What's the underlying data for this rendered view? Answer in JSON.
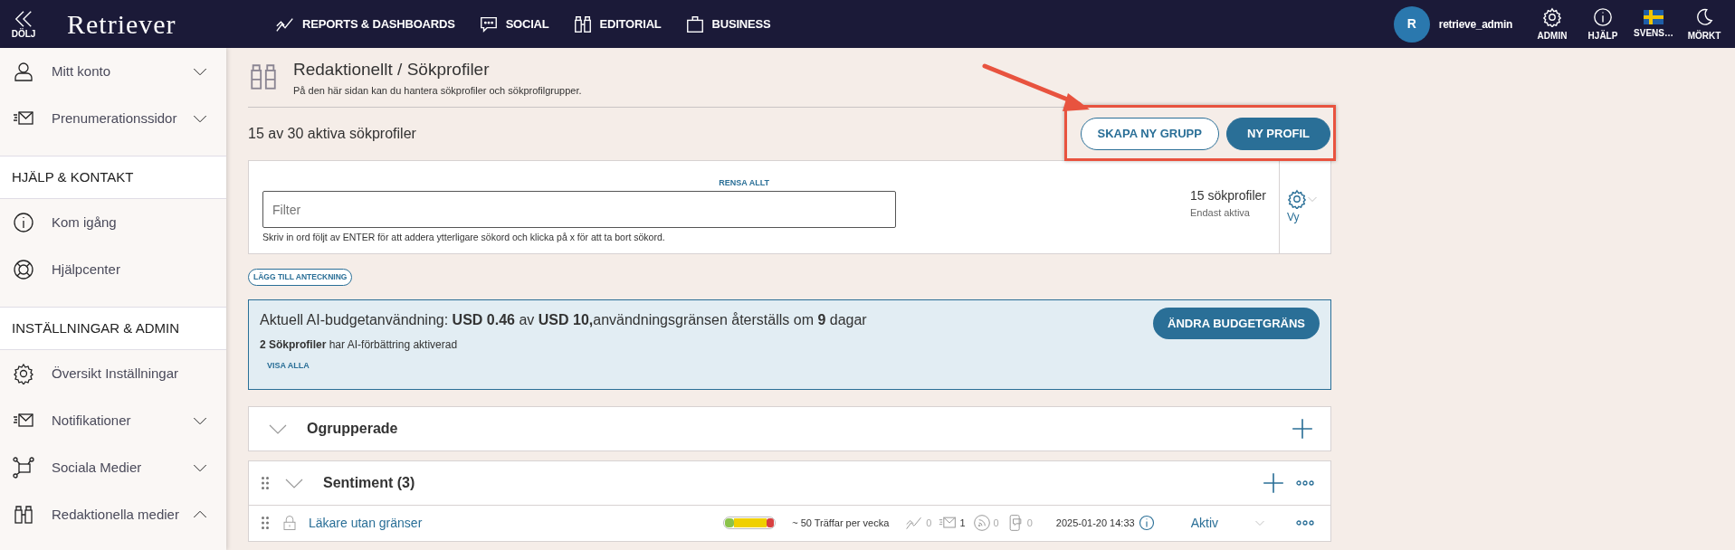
{
  "topbar": {
    "collapse_label": "DÖLJ",
    "logo": "Retriever",
    "nav": [
      {
        "label": "REPORTS & DASHBOARDS"
      },
      {
        "label": "SOCIAL"
      },
      {
        "label": "EDITORIAL"
      },
      {
        "label": "BUSINESS"
      }
    ],
    "user": {
      "initial": "R",
      "name": "retrieve_admin"
    },
    "tools": [
      {
        "label": "ADMIN"
      },
      {
        "label": "HJÄLP"
      },
      {
        "label": "SVENS…"
      },
      {
        "label": "MÖRKT"
      }
    ]
  },
  "sidebar": {
    "items": [
      {
        "kind": "item",
        "label": "Mitt konto",
        "expanded": false
      },
      {
        "kind": "item",
        "label": "Prenumerationssidor",
        "expanded": false
      },
      {
        "kind": "heading",
        "label": "HJÄLP & KONTAKT"
      },
      {
        "kind": "link",
        "label": "Kom igång"
      },
      {
        "kind": "link",
        "label": "Hjälpcenter"
      },
      {
        "kind": "heading",
        "label": "INSTÄLLNINGAR & ADMIN"
      },
      {
        "kind": "link",
        "label": "Översikt Inställningar"
      },
      {
        "kind": "item",
        "label": "Notifikationer",
        "expanded": false
      },
      {
        "kind": "item",
        "label": "Sociala Medier",
        "expanded": false
      },
      {
        "kind": "item",
        "label": "Redaktionella medier",
        "expanded": true
      }
    ]
  },
  "page": {
    "title": "Redaktionellt / Sökprofiler",
    "subtitle": "På den här sidan kan du hantera sökprofiler och sökprofilgrupper.",
    "count": "15 av 30 aktiva sökprofiler",
    "buttons": [
      {
        "label": "SKAPA NY GRUPP",
        "kind": "outline"
      },
      {
        "label": "NY PROFIL",
        "kind": "filled"
      }
    ],
    "filter": {
      "clear_label": "RENSA ALLT",
      "placeholder": "Filter",
      "hint": "Skriv in ord följt av ENTER för att addera ytterligare sökord och klicka på x för att ta bort sökord.",
      "result_count": "15 sökprofiler",
      "result_note": "Endast aktiva",
      "view_label": "Vy"
    },
    "note_button": "LÄGG TILL ANTECKNING",
    "ai_budget": {
      "usage": "Aktuell AI-budgetanvändning: **USD 0.46** av **USD 10,**användningsgränsen återställs om **9** dagar",
      "profiles": "**2 Sökprofiler** har AI-förbättring aktiverad",
      "link": "VISA ALLA",
      "button": "ÄNDRA BUDGETGRÄNS"
    },
    "groups": [
      {
        "kind": "ungrouped",
        "name": "Ogrupperade"
      },
      {
        "kind": "group",
        "name": "Sentiment (3)",
        "profiles": [
          {
            "name": "Läkare utan gränser",
            "locked": true,
            "hits": "~ 50 Träffar per vecka",
            "stats": [
              "0",
              "1",
              "0",
              "0"
            ],
            "date": "2025-01-20 14:33",
            "status": "Aktiv"
          }
        ]
      }
    ]
  }
}
